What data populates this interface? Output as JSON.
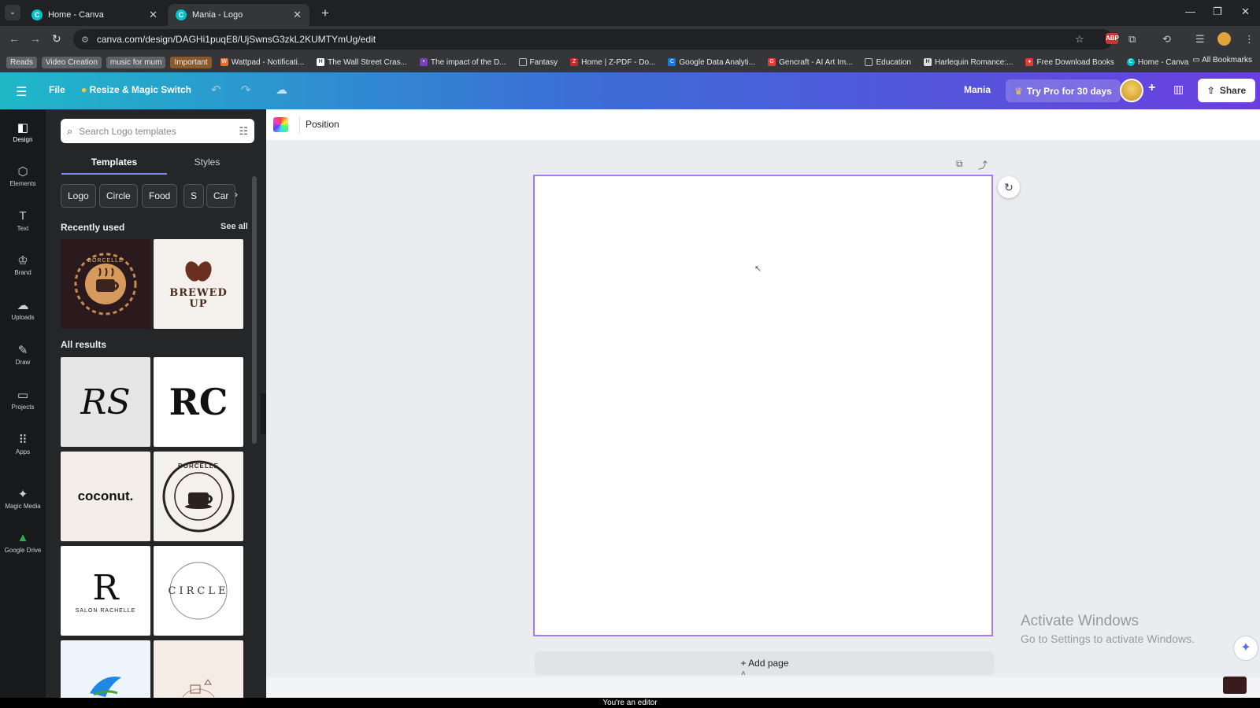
{
  "browser": {
    "tabs": [
      {
        "title": "Home - Canva",
        "active": false
      },
      {
        "title": "Mania - Logo",
        "active": true
      }
    ],
    "url": "canva.com/design/DAGHi1puqE8/UjSwnsG3zkL2KUMTYmUg/edit",
    "bookmarks": [
      {
        "label": "Reads",
        "style": "tag"
      },
      {
        "label": "Video Creation",
        "style": "tag"
      },
      {
        "label": "music for mum",
        "style": "tag"
      },
      {
        "label": "Important",
        "style": "tag-orange"
      },
      {
        "label": "Wattpad - Notificati...",
        "icon": "W"
      },
      {
        "label": "The Wall Street Cras...",
        "icon": "H"
      },
      {
        "label": "The impact of the D...",
        "icon": "•"
      },
      {
        "label": "Fantasy",
        "icon": "▭"
      },
      {
        "label": "Home | Z-PDF - Do...",
        "icon": "Z"
      },
      {
        "label": "Google Data Analyti...",
        "icon": "C"
      },
      {
        "label": "Gencraft - AI Art Im...",
        "icon": "G"
      },
      {
        "label": "Education",
        "icon": "▭"
      },
      {
        "label": "Harlequin Romance:...",
        "icon": "H"
      },
      {
        "label": "Free Download Books",
        "icon": "♦"
      },
      {
        "label": "Home - Canva",
        "icon": "C"
      }
    ],
    "all_bookmarks": "All Bookmarks"
  },
  "header": {
    "file": "File",
    "resize": "Resize & Magic Switch",
    "design_name": "Mania",
    "try_pro": "Try Pro for 30 days",
    "share": "Share"
  },
  "rail": [
    {
      "label": "Design",
      "icon": "design-icon",
      "glyph": "◧"
    },
    {
      "label": "Elements",
      "icon": "elements-icon",
      "glyph": "⬡"
    },
    {
      "label": "Text",
      "icon": "text-icon",
      "glyph": "T"
    },
    {
      "label": "Brand",
      "icon": "brand-icon",
      "glyph": "♔"
    },
    {
      "label": "Uploads",
      "icon": "uploads-icon",
      "glyph": "☁"
    },
    {
      "label": "Draw",
      "icon": "draw-icon",
      "glyph": "✎"
    },
    {
      "label": "Projects",
      "icon": "projects-icon",
      "glyph": "▭"
    },
    {
      "label": "Apps",
      "icon": "apps-icon",
      "glyph": "⠿"
    },
    {
      "label": "Magic Media",
      "icon": "magic-media-icon",
      "glyph": "✦"
    },
    {
      "label": "Google Drive",
      "icon": "google-drive-icon",
      "glyph": "▲"
    }
  ],
  "panel": {
    "search_placeholder": "Search Logo templates",
    "tabs": [
      "Templates",
      "Styles"
    ],
    "chips": [
      "Logo",
      "Circle",
      "Food",
      "S",
      "Car"
    ],
    "recently_used": "Recently used",
    "see_all": "See all",
    "all_results": "All results",
    "recent_thumbs": [
      {
        "name": "borcelle-coffee-wreath",
        "text": "BORCELLE",
        "bg": "#2a1a1e"
      },
      {
        "name": "brewed-up",
        "text": "BREWED\nUP",
        "bg": "#f4f1ec"
      }
    ],
    "result_thumbs": [
      {
        "name": "rs-monogram",
        "text": "RS",
        "bg": "#e6e6e6"
      },
      {
        "name": "rc-monogram",
        "text": "RC",
        "bg": "#ffffff"
      },
      {
        "name": "coconut",
        "text": "coconut.",
        "bg": "#f3efe8"
      },
      {
        "name": "borcelle-coffee-shop",
        "text": "BORCELLE",
        "bg": "#f4f1ec"
      },
      {
        "name": "salon-rachelle",
        "text": "SALON RACHELLE",
        "bg": "#ffffff"
      },
      {
        "name": "the-circle",
        "text": "CIRCLE",
        "bg": "#ffffff"
      },
      {
        "name": "blue-bird",
        "text": "",
        "bg": "#eef4fb"
      },
      {
        "name": "decor-furniture",
        "text": "",
        "bg": "#f6ece6"
      }
    ]
  },
  "editor": {
    "position": "Position",
    "add_page": "+ Add page",
    "activate_title": "Activate Windows",
    "activate_sub": "Go to Settings to activate Windows."
  },
  "banner": "You're an editor"
}
